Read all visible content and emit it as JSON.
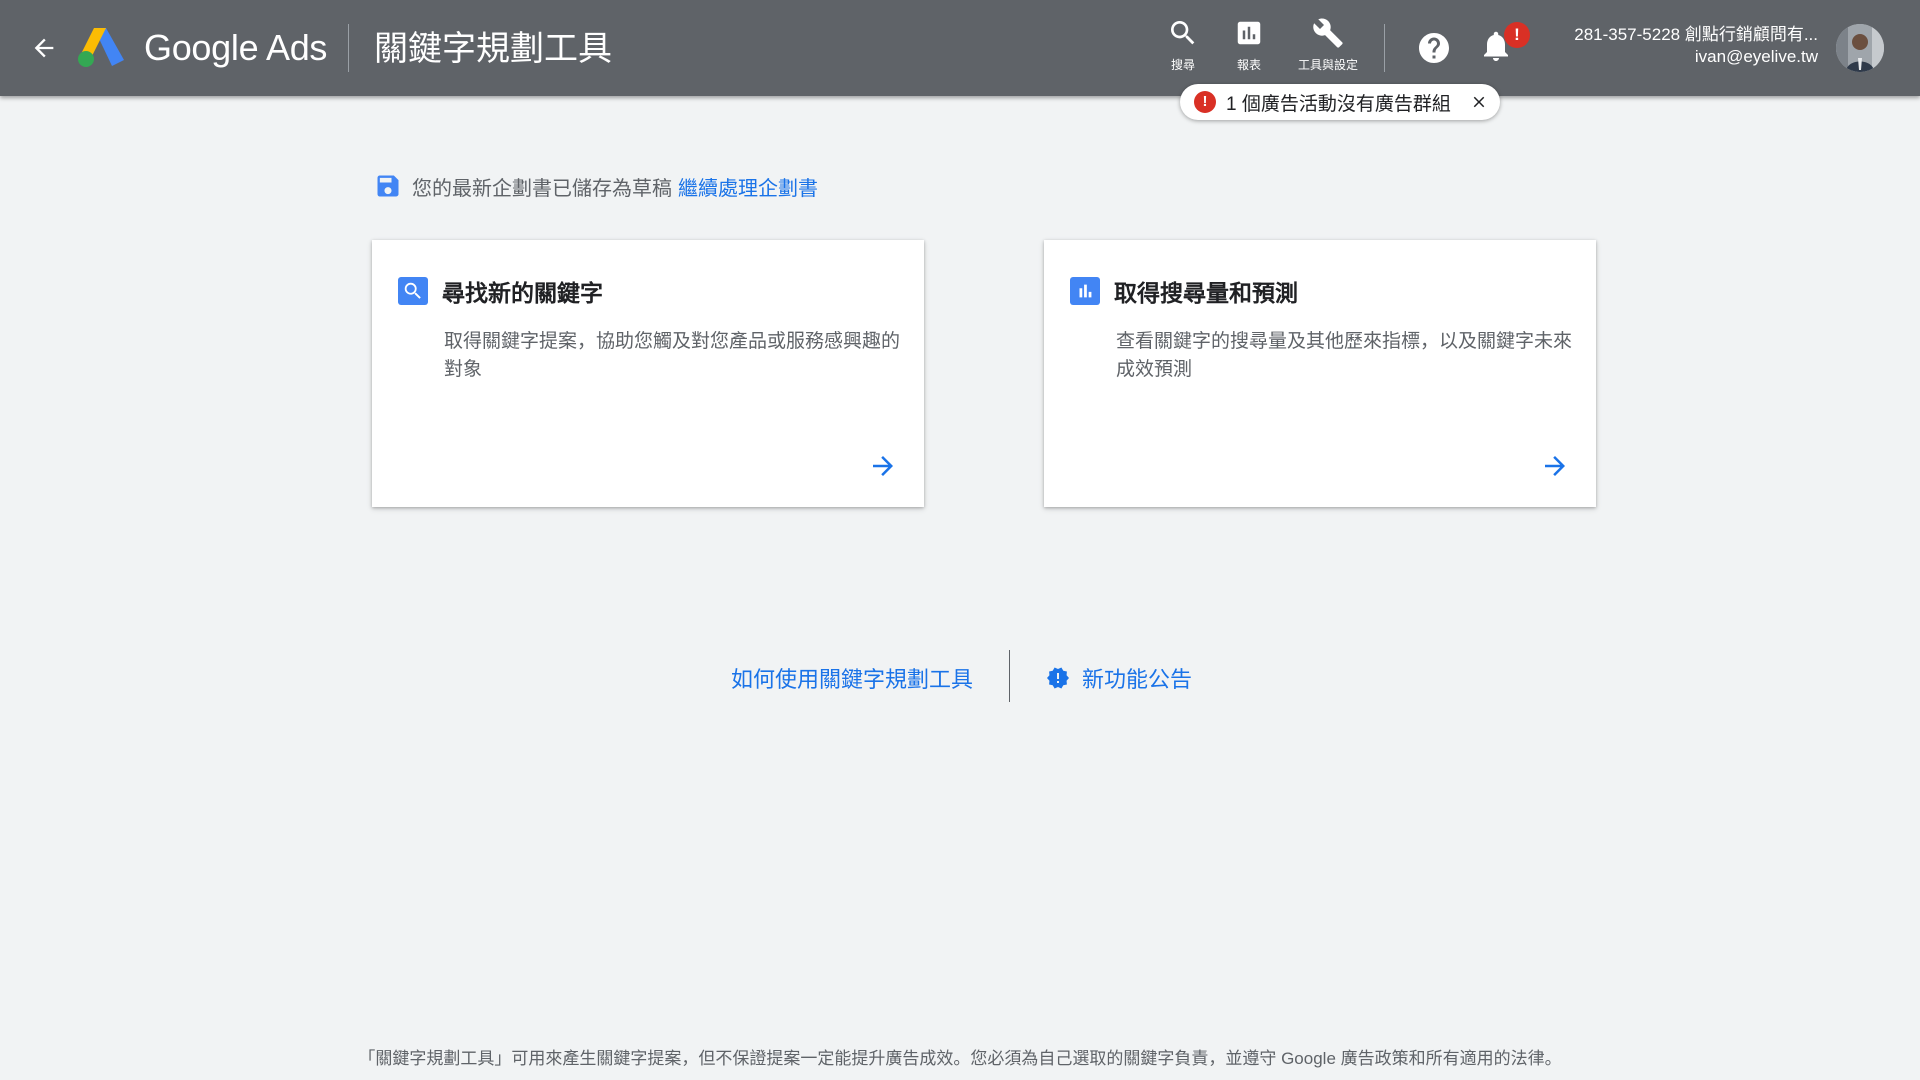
{
  "header": {
    "brand": "Google Ads",
    "page_title": "關鍵字規劃工具",
    "tools": {
      "search_label": "搜尋",
      "reports_label": "報表",
      "settings_label": "工具與設定"
    },
    "notification_badge": "!",
    "account": {
      "name": "281-357-5228 創點行銷顧問有...",
      "email": "ivan@eyelive.tw"
    }
  },
  "alert": {
    "icon": "!",
    "text": "1 個廣告活動沒有廣告群組"
  },
  "draft": {
    "text": "您的最新企劃書已儲存為草稿",
    "link": "繼續處理企劃書"
  },
  "cards": [
    {
      "title": "尋找新的關鍵字",
      "description": "取得關鍵字提案，協助您觸及對您產品或服務感興趣的對象",
      "icon": "search-icon"
    },
    {
      "title": "取得搜尋量和預測",
      "description": "查看關鍵字的搜尋量及其他歷來指標，以及關鍵字未來成效預測",
      "icon": "bar-chart-icon"
    }
  ],
  "help": {
    "how_to": "如何使用關鍵字規劃工具",
    "announcements": "新功能公告"
  },
  "footer": {
    "disclaimer": "「關鍵字規劃工具」可用來產生關鍵字提案，但不保證提案一定能提升廣告成效。您必須為自己選取的關鍵字負責，並遵守 Google 廣告政策和所有適用的法律。"
  },
  "colors": {
    "header_bg": "#5f6368",
    "page_bg": "#f1f3f4",
    "link_blue": "#1a73e8",
    "icon_blue": "#4285f4",
    "alert_red": "#d93025"
  }
}
